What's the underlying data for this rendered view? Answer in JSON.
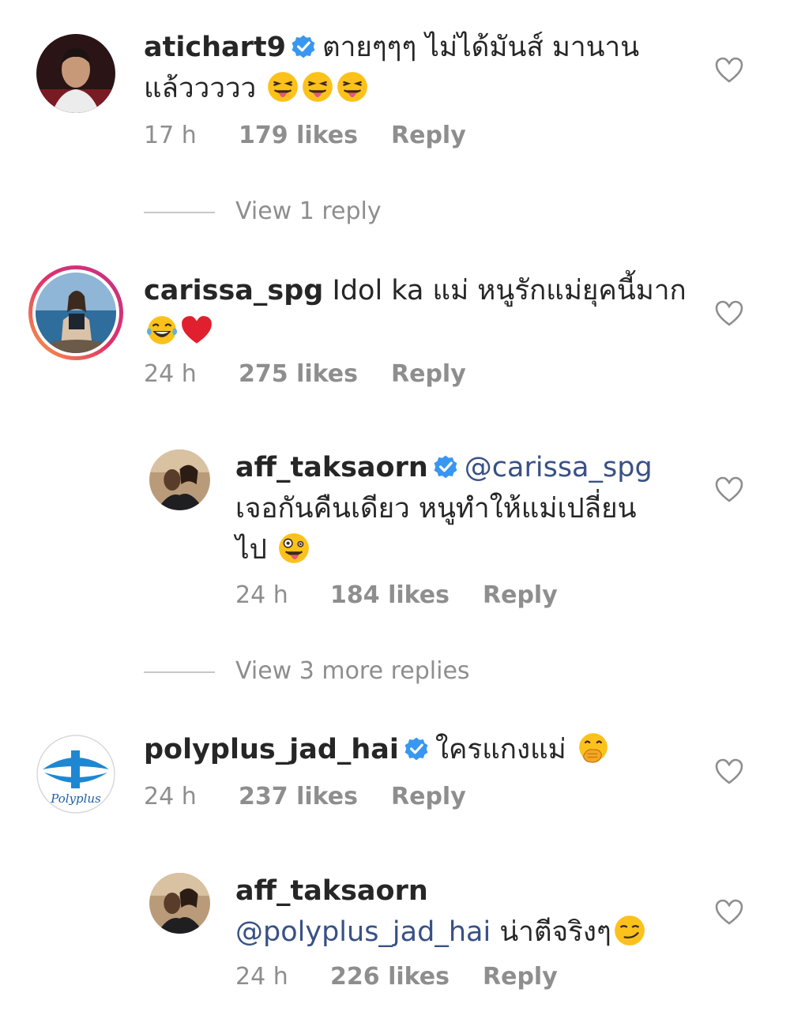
{
  "comments": [
    {
      "username": "atichart9",
      "verified": true,
      "text": "ตายๆๆๆ ไม่ได้มันส์ มานาน",
      "text2": "แล้ววววว",
      "emoji_count": 3,
      "time": "17 h",
      "likes": "179 likes",
      "reply": "Reply"
    },
    {
      "username": "carissa_spg",
      "verified": false,
      "text": "Idol ka แม่ หนูรักแม่ยุคนี้มาก",
      "time": "24 h",
      "likes": "275 likes",
      "reply": "Reply"
    },
    {
      "username": "aff_taksaorn",
      "verified": true,
      "mention": "@carissa_spg",
      "text": "เจอกันคืนเดียว หนูทำให้แม่เปลี่ยน",
      "text2": "ไป",
      "time": "24 h",
      "likes": "184 likes",
      "reply": "Reply"
    },
    {
      "username": "polyplus_jad_hai",
      "verified": true,
      "text": "ใครแกงแม่",
      "avatar_text": "Polyplus",
      "time": "24 h",
      "likes": "237 likes",
      "reply": "Reply"
    },
    {
      "username": "aff_taksaorn",
      "verified": false,
      "mention": "@polyplus_jad_hai",
      "text": "น่าตีจริงๆ",
      "time": "24 h",
      "likes": "226 likes",
      "reply": "Reply"
    }
  ],
  "view_replies": [
    {
      "label": "View 1 reply"
    },
    {
      "label": "View 3 more replies"
    }
  ],
  "colors": {
    "text": "#262626",
    "meta": "#8e8e8e",
    "mention": "#385185",
    "verified": "#3897f0"
  }
}
